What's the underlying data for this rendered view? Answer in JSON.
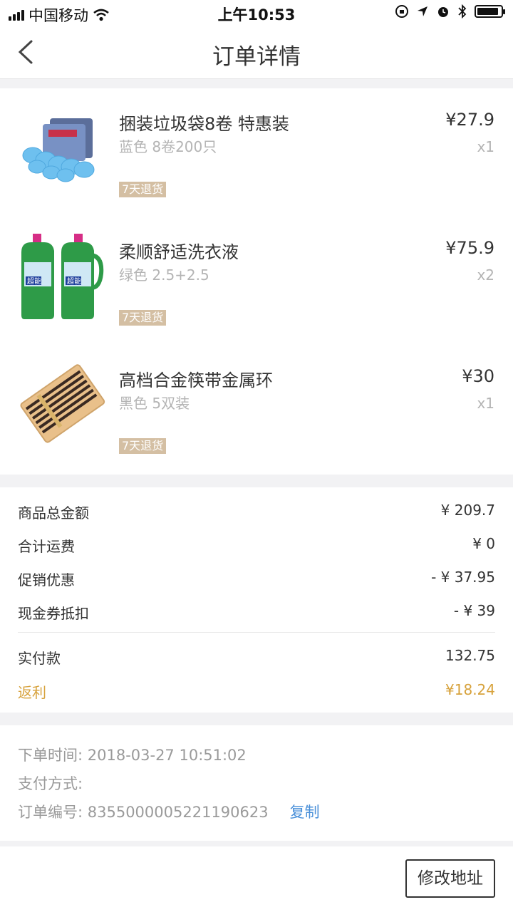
{
  "status_bar": {
    "carrier": "中国移动",
    "time": "上午10:53",
    "battery_level": 0.9
  },
  "nav": {
    "title": "订单详情"
  },
  "items": [
    {
      "name": "捆装垃圾袋8卷 特惠装",
      "spec": "蓝色  8卷200只",
      "price": "¥27.9",
      "qty": "x1",
      "badge": "7天退货"
    },
    {
      "name": "柔顺舒适洗衣液",
      "spec": "绿色  2.5+2.5",
      "price": "¥75.9",
      "qty": "x2",
      "badge": "7天退货",
      "bottle_label": "超能"
    },
    {
      "name": "高档合金筷带金属环",
      "spec": "黑色  5双装",
      "price": "¥30",
      "qty": "x1",
      "badge": "7天退货"
    }
  ],
  "summary": {
    "rows": [
      {
        "label": "商品总金额",
        "value": "¥ 209.7"
      },
      {
        "label": "合计运费",
        "value": "¥ 0"
      },
      {
        "label": "促销优惠",
        "value": "- ¥ 37.95"
      },
      {
        "label": "现金券抵扣",
        "value": "- ¥ 39"
      }
    ],
    "paid_label": "实付款",
    "paid_value": "132.75",
    "rebate_label": "返利",
    "rebate_value": "¥18.24"
  },
  "order_info": {
    "time": "下单时间: 2018-03-27 10:51:02",
    "payment": "支付方式:",
    "number": "订单编号: 8355000005221190623",
    "copy_label": "复制"
  },
  "footer": {
    "modify_address_label": "修改地址"
  },
  "colors": {
    "badge": "#d4bfa3",
    "rebate": "#d7a23c",
    "link": "#4a90d9"
  }
}
